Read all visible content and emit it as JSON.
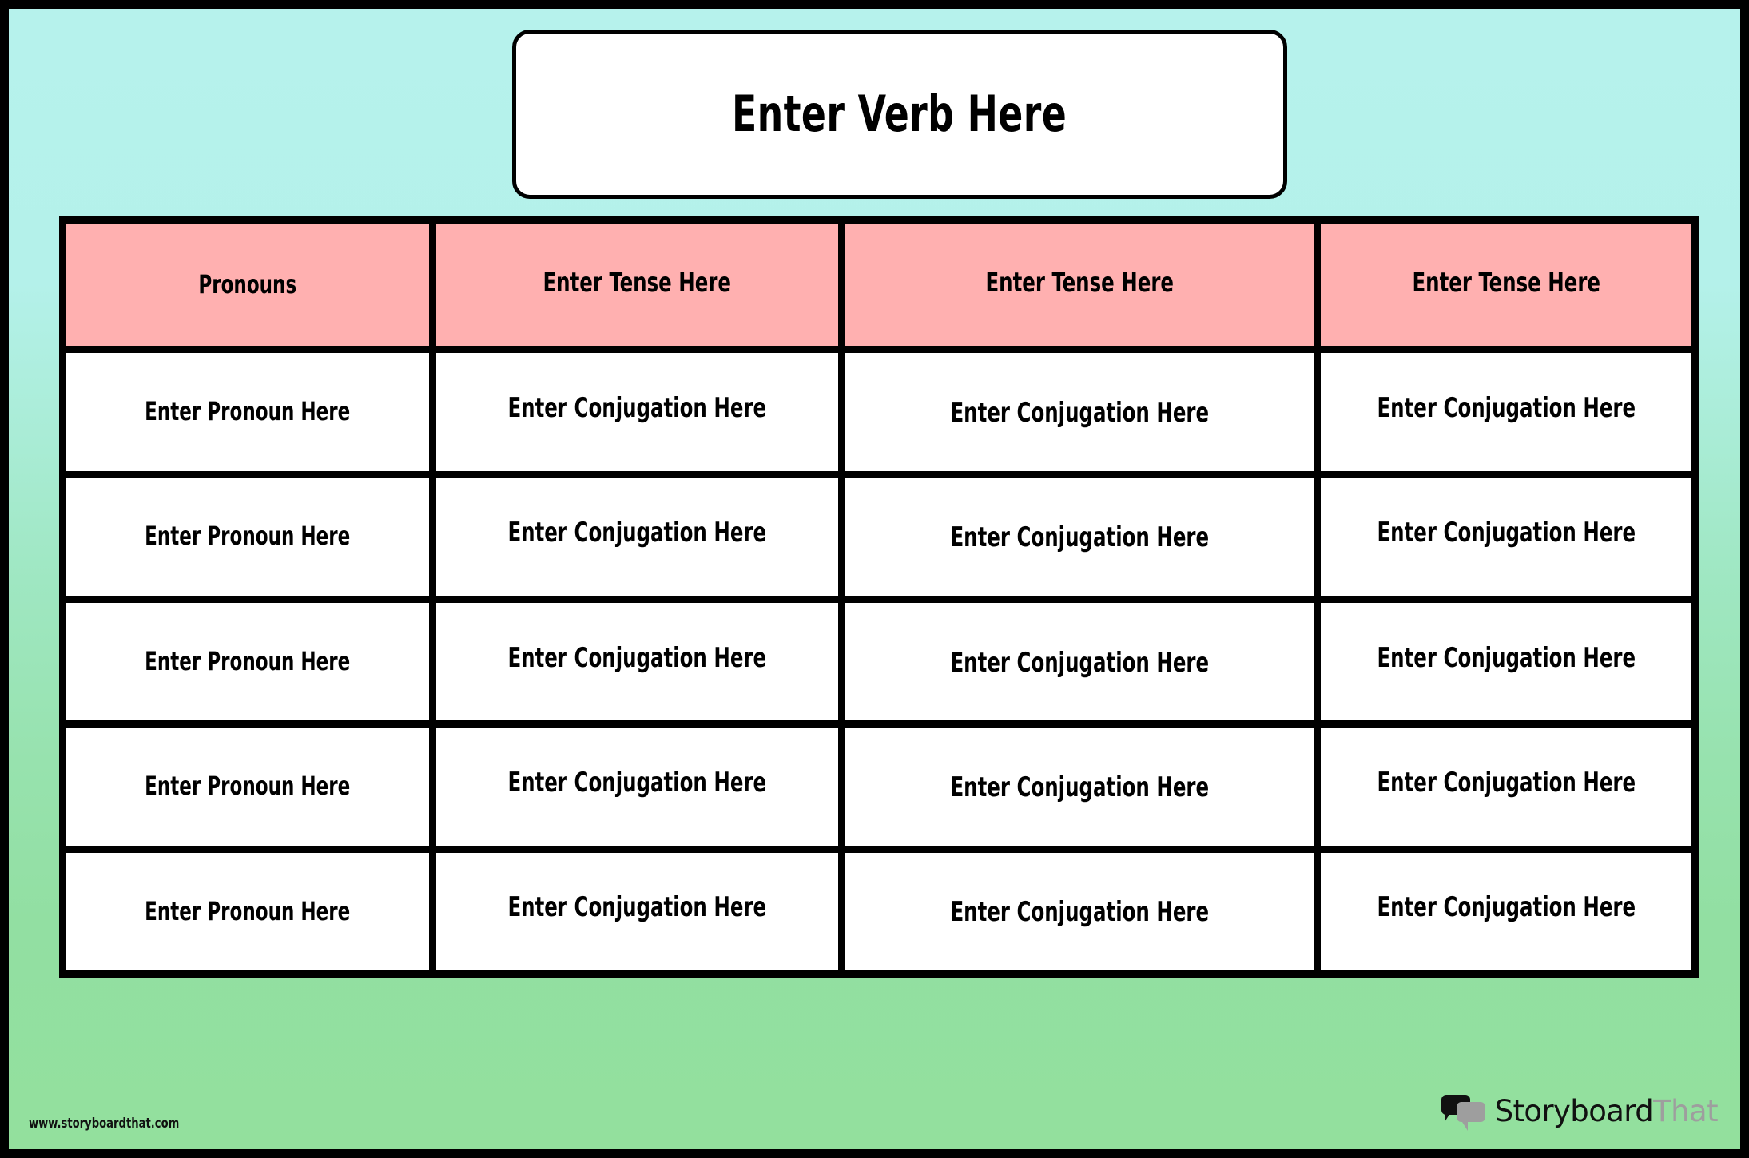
{
  "worksheet": {
    "prompt_bubble": {
      "text": "Enter Verb Here"
    },
    "table": {
      "headers": [
        "Pronouns",
        "Enter Tense Here",
        "Enter Tense Here",
        "Enter Tense Here"
      ],
      "rows": [
        [
          "Enter Pronoun Here",
          "Enter Conjugation Here",
          "Enter Conjugation Here",
          "Enter Conjugation Here"
        ],
        [
          "Enter Pronoun Here",
          "Enter Conjugation Here",
          "Enter Conjugation Here",
          "Enter Conjugation Here"
        ],
        [
          "Enter Pronoun Here",
          "Enter Conjugation Here",
          "Enter Conjugation Here",
          "Enter Conjugation Here"
        ],
        [
          "Enter Pronoun Here",
          "Enter Conjugation Here",
          "Enter Conjugation Here",
          "Enter Conjugation Here"
        ],
        [
          "Enter Pronoun Here",
          "Enter Conjugation Here",
          "Enter Conjugation Here",
          "Enter Conjugation Here"
        ]
      ]
    }
  },
  "footer": {
    "site_url": "www.storyboardthat.com",
    "brand": {
      "name_primary": "Storyboard",
      "name_secondary": "That",
      "mark_icon": "speech-bubbles-icon"
    }
  },
  "colors": {
    "frame": "#000000",
    "background_top": "#b6f2ec",
    "background_bottom": "#93e09d",
    "header_cell": "#ffb0b0",
    "body_cell": "#ffffff",
    "text": "#000000",
    "brand_primary": "#111111",
    "brand_secondary": "#9e9e9e"
  }
}
